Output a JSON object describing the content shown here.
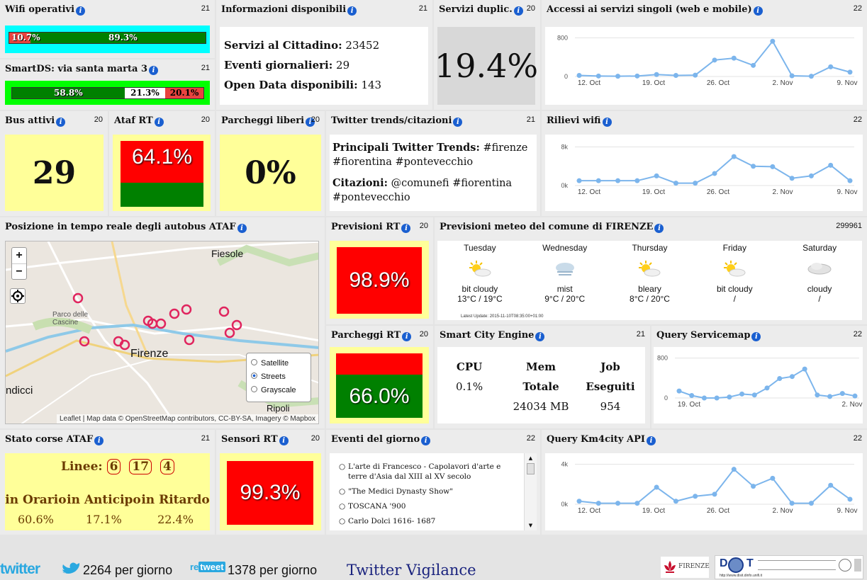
{
  "wifi": {
    "title": "Wifi operativi",
    "count": "21",
    "red": "10.7%",
    "green": "89.3%",
    "red_frac": 0.107
  },
  "smartds": {
    "title": "SmartDS: via santa marta 3",
    "count": "21",
    "a": "58.8%",
    "b": "21.3%",
    "c": "20.1%"
  },
  "info": {
    "title": "Informazioni disponibili",
    "count": "21",
    "l1k": "Servizi al Cittadino:",
    "l1v": "23452",
    "l2k": "Eventi giornalieri:",
    "l2v": "29",
    "l3k": "Open Data disponibili:",
    "l3v": "143"
  },
  "dup": {
    "title": "Servizi duplic.",
    "count": "20",
    "value": "19.4%"
  },
  "accessi": {
    "title": "Accessi ai servizi singoli (web e mobile)",
    "count": "22"
  },
  "bus": {
    "title": "Bus attivi",
    "count": "20",
    "value": "29"
  },
  "ataf": {
    "title": "Ataf RT",
    "count": "20",
    "value": "64.1%"
  },
  "parch": {
    "title": "Parcheggi liberi",
    "count": "20",
    "value": "0%"
  },
  "twitter": {
    "title": "Twitter trends/citazioni",
    "count": "21",
    "t_label": "Principali Twitter Trends:",
    "t_text": "#firenze #fiorentina #pontevecchio",
    "c_label": "Citazioni:",
    "c_text": "@comunefi #fiorentina #pontevecchio"
  },
  "rilievi": {
    "title": "Rilievi wifi",
    "count": "22"
  },
  "map": {
    "title": "Posizione in tempo reale degli autobus ATAF",
    "zoom_in": "+",
    "zoom_out": "−",
    "fiesole": "Fiesole",
    "parco": "Parco delle",
    "cascine": "Cascine",
    "firenze": "Firenze",
    "ndicci": "ndicci",
    "ripoli": "Ripoli",
    "layers": [
      "Satellite",
      "Streets",
      "Grayscale"
    ],
    "attribution": "Leaflet | Map data © OpenStreetMap contributors, CC-BY-SA, Imagery © Mapbox"
  },
  "prevrt": {
    "title": "Previsioni RT",
    "count": "20",
    "value": "98.9%"
  },
  "meteo": {
    "title": "Previsioni meteo del comune di FIRENZE",
    "count": "299961",
    "days": [
      {
        "day": "Tuesday",
        "desc": "bit cloudy",
        "temp": "13°C / 19°C",
        "icon": "sun-cloud"
      },
      {
        "day": "Wednesday",
        "desc": "mist",
        "temp": "9°C / 20°C",
        "icon": "mist"
      },
      {
        "day": "Thursday",
        "desc": "bleary",
        "temp": "8°C / 20°C",
        "icon": "sun-cloud"
      },
      {
        "day": "Friday",
        "desc": "bit cloudy",
        "temp": "/",
        "icon": "sun-cloud"
      },
      {
        "day": "Saturday",
        "desc": "cloudy",
        "temp": "/",
        "icon": "cloud"
      }
    ],
    "update": "Latest Update: 2015-11-10T08:35:00+01:00"
  },
  "parchrt": {
    "title": "Parcheggi RT",
    "count": "20",
    "value": "66.0%"
  },
  "engine": {
    "title": "Smart City Engine",
    "count": "21",
    "cpu_h": "CPU",
    "cpu_v": "0.1%",
    "mem_h1": "Mem",
    "mem_h2": "Totale",
    "mem_v": "24034 MB",
    "job_h1": "Job",
    "job_h2": "Eseguiti",
    "job_v": "954"
  },
  "query": {
    "title": "Query Servicemap",
    "count": "22"
  },
  "stato": {
    "title": "Stato corse ATAF",
    "count": "21",
    "linee": "Linee:",
    "l1": "6",
    "l2": "17",
    "l3": "4",
    "h1": "in Orario",
    "h2": "in Anticipo",
    "h3": "in Ritardo",
    "v1": "60.6%",
    "v2": "17.1%",
    "v3": "22.4%"
  },
  "sensori": {
    "title": "Sensori RT",
    "count": "20",
    "value": "99.3%"
  },
  "eventi": {
    "title": "Eventi del giorno",
    "count": "22",
    "items": [
      "L'arte di Francesco - Capolavori d'arte e terre d'Asia dal XIII al XV secolo",
      "\"The Medici Dynasty Show\"",
      "TOSCANA '900",
      "Carlo Dolci 1616- 1687"
    ]
  },
  "km4": {
    "title": "Query Km4city API",
    "count": "22"
  },
  "footer": {
    "twitter_logo": "twitter",
    "per1": "2264 per giorno",
    "retweet_re": "re",
    "retweet_word": "tweet",
    "per2": "1378 per giorno",
    "vigilance": "Twitter Vigilance",
    "firenze_logo": "FIRENZE",
    "dot_d": "D",
    "dot_t": "T",
    "url": "http://www.disit.dinfo.unifi.it"
  },
  "chart_data": [
    {
      "type": "line",
      "name": "accessi",
      "yticks": [
        "800",
        "0"
      ],
      "ylim": [
        0,
        880
      ],
      "xticks": [
        "12. Oct",
        "19. Oct",
        "26. Oct",
        "2. Nov",
        "9. Nov"
      ],
      "x": [
        0,
        3,
        10,
        14,
        16,
        17,
        20,
        21,
        22,
        23,
        24,
        25,
        26,
        27
      ],
      "y": [
        22,
        10,
        5,
        10,
        40,
        22,
        28,
        340,
        380,
        230,
        730,
        15,
        5,
        200,
        90
      ]
    },
    {
      "type": "line",
      "name": "rilievi",
      "yticks": [
        "8k",
        "0k"
      ],
      "ylim": [
        0,
        8800
      ],
      "xticks": [
        "12. Oct",
        "19. Oct",
        "26. Oct",
        "2. Nov",
        "9. Nov"
      ],
      "x": [
        0,
        3,
        10,
        14,
        16,
        17,
        20,
        21,
        22,
        23,
        24,
        25,
        26,
        27
      ],
      "y": [
        1000,
        1000,
        1000,
        1000,
        2000,
        500,
        500,
        2500,
        6000,
        4000,
        3900,
        1500,
        2000,
        4200,
        1000
      ]
    },
    {
      "type": "line",
      "name": "query",
      "yticks": [
        "800",
        "0"
      ],
      "ylim": [
        0,
        880
      ],
      "xticks": [
        "19. Oct",
        "2. Nov"
      ],
      "x": [
        0,
        2,
        5,
        9,
        12,
        13,
        14,
        15,
        16,
        17,
        18,
        19,
        20
      ],
      "y": [
        140,
        50,
        0,
        0,
        20,
        80,
        60,
        200,
        390,
        430,
        580,
        60,
        30,
        90,
        40
      ]
    },
    {
      "type": "line",
      "name": "km4",
      "yticks": [
        "4k",
        "0k"
      ],
      "ylim": [
        0,
        4400
      ],
      "xticks": [
        "12. Oct",
        "19. Oct",
        "26. Oct",
        "2. Nov",
        "9. Nov"
      ],
      "x": [
        0,
        3,
        10,
        14,
        16,
        17,
        20,
        21,
        22,
        23,
        24,
        25,
        26,
        27
      ],
      "y": [
        300,
        100,
        100,
        100,
        1700,
        300,
        800,
        1000,
        3500,
        1800,
        2600,
        100,
        100,
        1900,
        500
      ]
    }
  ]
}
